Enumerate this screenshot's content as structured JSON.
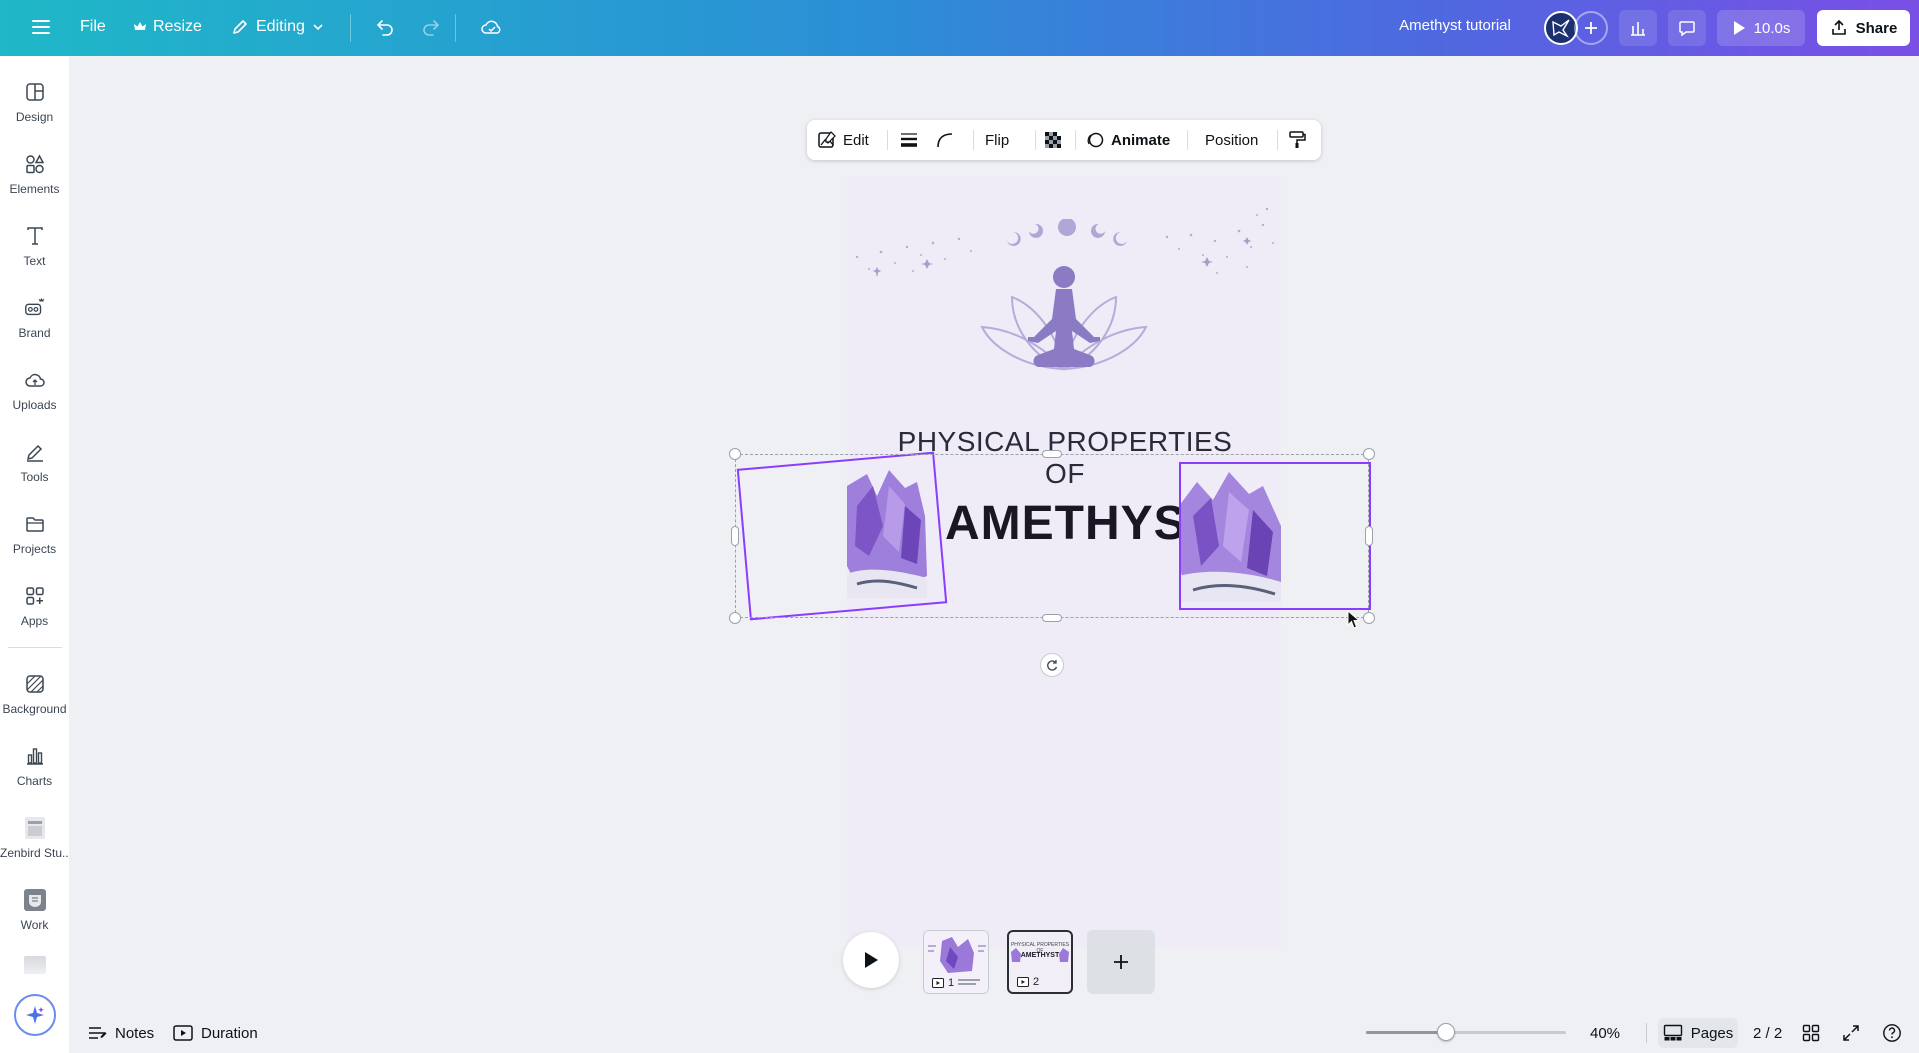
{
  "topbar": {
    "file_label": "File",
    "resize_label": "Resize",
    "editing_label": "Editing",
    "doc_title": "Amethyst tutorial",
    "play_duration": "10.0s",
    "share_label": "Share"
  },
  "sidebar": {
    "items": [
      {
        "label": "Design",
        "icon": "layout-icon"
      },
      {
        "label": "Elements",
        "icon": "shapes-icon"
      },
      {
        "label": "Text",
        "icon": "text-icon"
      },
      {
        "label": "Brand",
        "icon": "brand-icon"
      },
      {
        "label": "Uploads",
        "icon": "cloud-upload-icon"
      },
      {
        "label": "Tools",
        "icon": "pen-icon"
      },
      {
        "label": "Projects",
        "icon": "folder-icon"
      },
      {
        "label": "Apps",
        "icon": "apps-icon"
      },
      {
        "label": "Background",
        "icon": "background-icon"
      },
      {
        "label": "Charts",
        "icon": "chart-icon"
      },
      {
        "label": "Zenbird Stu...",
        "icon": "zenbird-app-icon"
      },
      {
        "label": "Work",
        "icon": "work-app-icon"
      }
    ]
  },
  "context_toolbar": {
    "edit_label": "Edit",
    "flip_label": "Flip",
    "animate_label": "Animate",
    "position_label": "Position"
  },
  "design": {
    "heading_small": "PHYSICAL PROPERTIES OF",
    "heading_big": "AMETHYST"
  },
  "pages": {
    "thumbs": [
      {
        "number": "1"
      },
      {
        "number": "2"
      }
    ],
    "thumb2_small": "PHYSICAL PROPERTIES OF",
    "thumb2_big": "AMETHYST"
  },
  "bottombar": {
    "notes_label": "Notes",
    "duration_label": "Duration",
    "zoom": "40%",
    "zoom_fraction": 0.4,
    "pages_label": "Pages",
    "page_indicator": "2 / 2"
  },
  "colors": {
    "accent": "#8b3dff",
    "page_bg": "#efebf7",
    "silhouette": "#8a7bc4"
  }
}
